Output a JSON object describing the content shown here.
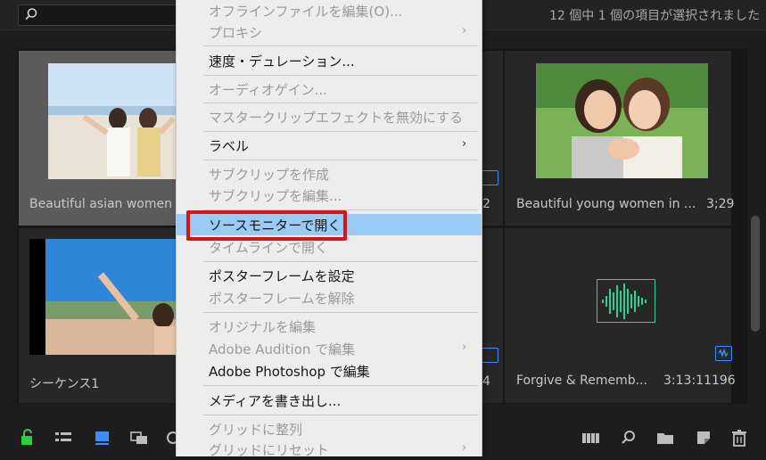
{
  "status_text": "12 個中 1 個の項目が選択されました",
  "items": [
    {
      "caption": "Beautiful asian women",
      "duration": "2"
    },
    {
      "caption": "Beautiful young women in ...",
      "duration": "3;29"
    },
    {
      "caption": "シーケンス1",
      "duration": "4"
    },
    {
      "caption": "Forgive & Rememb...",
      "duration": "3:13:11196"
    }
  ],
  "menu": [
    {
      "label": "オフラインファイルを編集(O)...",
      "enabled": false
    },
    {
      "label": "プロキシ",
      "enabled": false,
      "submenu": true
    },
    {
      "label": "速度・デュレーション...",
      "enabled": true
    },
    {
      "label": "オーディオゲイン...",
      "enabled": false
    },
    {
      "label": "マスタークリップエフェクトを無効にする",
      "enabled": false
    },
    {
      "label": "ラベル",
      "enabled": true,
      "submenu": true
    },
    {
      "label": "サブクリップを作成",
      "enabled": false
    },
    {
      "label": "サブクリップを編集...",
      "enabled": false
    },
    {
      "label": "ソースモニターで開く",
      "enabled": true,
      "highlighted": true
    },
    {
      "label": "タイムラインで開く",
      "enabled": false
    },
    {
      "label": "ポスターフレームを設定",
      "enabled": true
    },
    {
      "label": "ポスターフレームを解除",
      "enabled": false
    },
    {
      "label": "オリジナルを編集",
      "enabled": false
    },
    {
      "label": "Adobe Audition で編集",
      "enabled": false,
      "submenu": true
    },
    {
      "label": "Adobe Photoshop で編集",
      "enabled": true
    },
    {
      "label": "メディアを書き出し...",
      "enabled": true
    },
    {
      "label": "グリッドに整列",
      "enabled": false
    },
    {
      "label": "グリッドにリセット",
      "enabled": false,
      "submenu": true
    }
  ],
  "icons": {
    "search": "magnifier-icon",
    "lock": "lock-icon",
    "list_view": "list-view-icon",
    "icon_view": "icon-view-icon",
    "freeform_view": "freeform-view-icon",
    "automate": "automate-to-sequence-icon",
    "find": "find-icon",
    "new_bin": "new-bin-icon",
    "new_item": "new-item-icon",
    "delete": "trash-icon"
  },
  "colors": {
    "accent": "#3d8cff",
    "lock_green": "#2ecc40",
    "highlight": "#99cbf5",
    "callout_red": "#d4161c"
  }
}
